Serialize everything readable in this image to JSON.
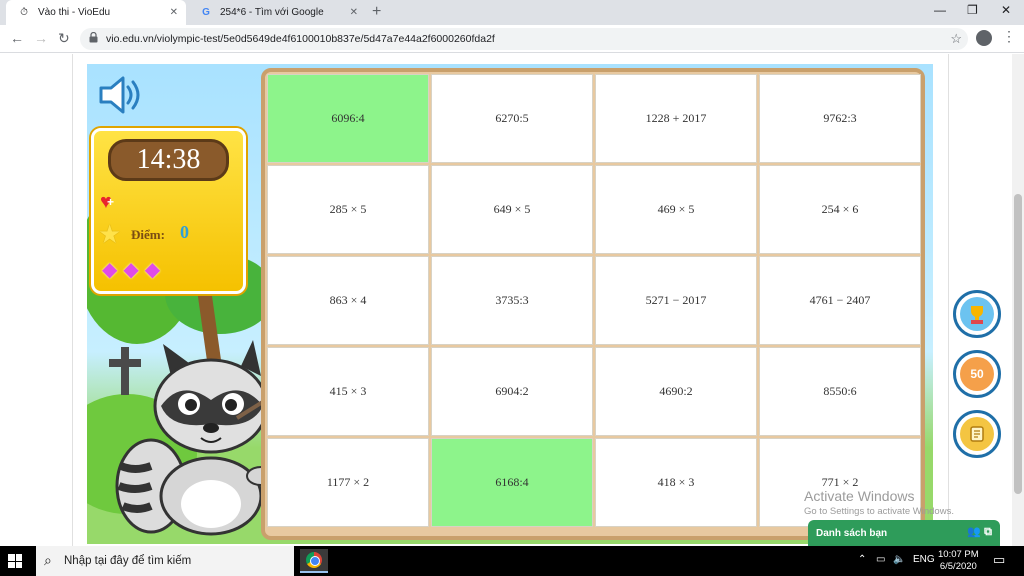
{
  "browser": {
    "tabs": [
      {
        "title": "Vào thi - VioEdu",
        "icon": "stopwatch-icon",
        "active": true
      },
      {
        "title": "254*6 - Tìm với Google",
        "icon": "google-icon",
        "active": false
      }
    ],
    "url": "vio.edu.vn/violympic-test/5e0d5649de4f6100010b837e/5d47a7e44a2f6000260fda2f"
  },
  "game": {
    "timer": "14:38",
    "score_label": "Điểm:",
    "score_value": "0",
    "lives_count": 3,
    "cards": [
      {
        "text": "6096:4",
        "selected": true
      },
      {
        "text": "6270:5",
        "selected": false
      },
      {
        "text": "1228 + 2017",
        "selected": false
      },
      {
        "text": "9762:3",
        "selected": false
      },
      {
        "text": "285 × 5",
        "selected": false
      },
      {
        "text": "649 × 5",
        "selected": false
      },
      {
        "text": "469 × 5",
        "selected": false
      },
      {
        "text": "254 × 6",
        "selected": false
      },
      {
        "text": "863 × 4",
        "selected": false
      },
      {
        "text": "3735:3",
        "selected": false
      },
      {
        "text": "5271 − 2017",
        "selected": false
      },
      {
        "text": "4761 − 2407",
        "selected": false
      },
      {
        "text": "415 × 3",
        "selected": false
      },
      {
        "text": "6904:2",
        "selected": false
      },
      {
        "text": "4690:2",
        "selected": false
      },
      {
        "text": "8550:6",
        "selected": false
      },
      {
        "text": "1177 × 2",
        "selected": false
      },
      {
        "text": "6168:4",
        "selected": true
      },
      {
        "text": "418 × 3",
        "selected": false
      },
      {
        "text": "771 × 2",
        "selected": false
      }
    ],
    "side_buttons": [
      {
        "name": "leaderboard-button",
        "icon": "trophy-icon"
      },
      {
        "name": "diamond-50-button",
        "icon": "diamond-icon",
        "label": "50"
      },
      {
        "name": "scroll-button",
        "icon": "scroll-icon"
      }
    ],
    "friends_panel_label": "Danh sách bạn"
  },
  "watermark": {
    "line1": "Activate Windows",
    "line2": "Go to Settings to activate Windows."
  },
  "taskbar": {
    "search_placeholder": "Nhập tại đây để tìm kiếm",
    "language": "ENG",
    "time": "10:07 PM",
    "date": "6/5/2020"
  },
  "colors": {
    "selected_card": "#8df48b",
    "board_border": "#c9a06c",
    "friends_panel": "#2e9c5a"
  }
}
